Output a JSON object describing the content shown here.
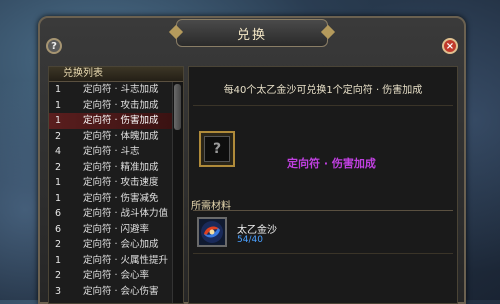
{
  "dialog": {
    "title": "兑换",
    "help_icon": "?",
    "close_icon": "×"
  },
  "list": {
    "header": "兑换列表",
    "items": [
      {
        "num": "1",
        "name": "定向符 · 斗志加成",
        "selected": false
      },
      {
        "num": "1",
        "name": "定向符 · 攻击加成",
        "selected": false
      },
      {
        "num": "1",
        "name": "定向符 · 伤害加成",
        "selected": true
      },
      {
        "num": "2",
        "name": "定向符 · 体魄加成",
        "selected": false
      },
      {
        "num": "4",
        "name": "定向符 · 斗志",
        "selected": false
      },
      {
        "num": "2",
        "name": "定向符 · 精准加成",
        "selected": false
      },
      {
        "num": "1",
        "name": "定向符 · 攻击速度",
        "selected": false
      },
      {
        "num": "1",
        "name": "定向符 · 伤害减免",
        "selected": false
      },
      {
        "num": "6",
        "name": "定向符 · 战斗体力值",
        "selected": false
      },
      {
        "num": "6",
        "name": "定向符 · 闪避率",
        "selected": false
      },
      {
        "num": "2",
        "name": "定向符 · 会心加成",
        "selected": false
      },
      {
        "num": "1",
        "name": "定向符 · 火属性提升",
        "selected": false
      },
      {
        "num": "2",
        "name": "定向符 · 会心率",
        "selected": false
      },
      {
        "num": "3",
        "name": "定向符 · 会心伤害",
        "selected": false
      }
    ]
  },
  "detail": {
    "description": "每40个太乙金沙可兑换1个定向符 · 伤害加成",
    "slot_icon": "?",
    "target_name": "定向符 · 伤害加成",
    "materials_header": "所需材料",
    "material_name": "太乙金沙",
    "material_count": "54/40"
  },
  "colors": {
    "accent_gold": "#b08b3a",
    "purple_item": "#c040e0",
    "count_blue": "#4aa0ff",
    "close_red": "#c0392b"
  }
}
